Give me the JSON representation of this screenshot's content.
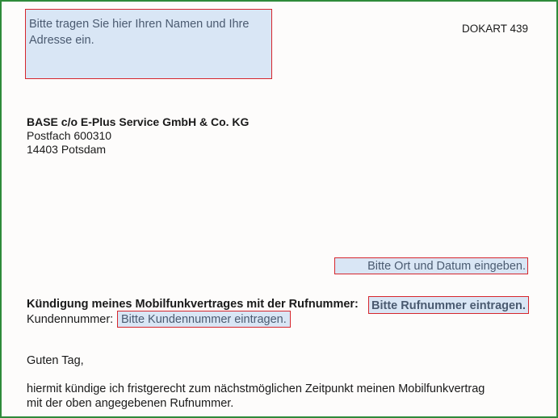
{
  "document": {
    "sender_placeholder_line1": "Bitte tragen Sie hier Ihren Namen und Ihre",
    "sender_placeholder_line2": "Adresse ein.",
    "doc_number": "DOKART 439",
    "recipient": {
      "company": "BASE c/o E-Plus Service GmbH & Co. KG",
      "po_box": "Postfach 600310",
      "city": "14403 Potsdam"
    },
    "date_placeholder": "Bitte Ort und Datum eingeben.",
    "subject_label": "Kündigung meines Mobilfunkvertrages mit der Rufnummer:",
    "phone_placeholder": "Bitte Rufnummer eintragen.",
    "customer_label": "Kundennummer:",
    "customer_placeholder": "Bitte Kundennummer eintragen.",
    "greeting": "Guten Tag,",
    "body_line1": "hiermit kündige ich fristgerecht zum nächstmöglichen Zeitpunkt meinen Mobilfunkvertrag",
    "body_line2": "mit der oben angegebenen Rufnummer."
  },
  "colors": {
    "page_border": "#2e8b3a",
    "field_fill": "#d9e6f5",
    "field_border": "#d6262d",
    "field_text": "#4a5a70"
  }
}
